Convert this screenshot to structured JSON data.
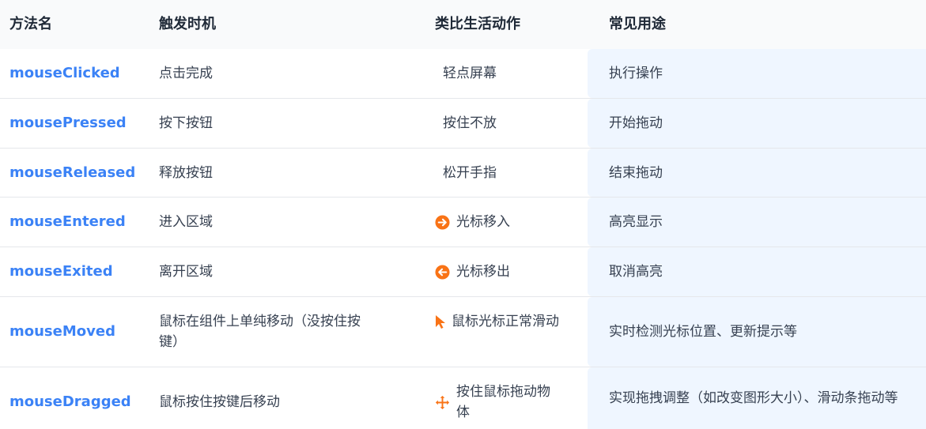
{
  "headers": {
    "method": "方法名",
    "trigger": "触发时机",
    "analogy": "类比生活动作",
    "usage": "常见用途"
  },
  "colors": {
    "method_text": "#3b82f6",
    "icon_orange": "#f97316",
    "usage_bg": "#eff6ff",
    "header_bg": "#f9fafb"
  },
  "rows": [
    {
      "method": "mouseClicked",
      "trigger": "点击完成",
      "analogy": "轻点屏幕",
      "analogy_icon": "",
      "usage": "执行操作"
    },
    {
      "method": "mousePressed",
      "trigger": "按下按钮",
      "analogy": "按住不放",
      "analogy_icon": "",
      "usage": "开始拖动"
    },
    {
      "method": "mouseReleased",
      "trigger": "释放按钮",
      "analogy": "松开手指",
      "analogy_icon": "",
      "usage": "结束拖动"
    },
    {
      "method": "mouseEntered",
      "trigger": "进入区域",
      "analogy": "光标移入",
      "analogy_icon": "arrow-circle-right-icon",
      "usage": "高亮显示"
    },
    {
      "method": "mouseExited",
      "trigger": "离开区域",
      "analogy": "光标移出",
      "analogy_icon": "arrow-circle-left-icon",
      "usage": "取消高亮"
    },
    {
      "method": "mouseMoved",
      "trigger": "鼠标在组件上单纯移动（没按住按键）",
      "analogy": "鼠标光标正常滑动",
      "analogy_icon": "mouse-pointer-icon",
      "usage": "实时检测光标位置、更新提示等"
    },
    {
      "method": "mouseDragged",
      "trigger": "鼠标按住按键后移动",
      "analogy": "按住鼠标拖动物体",
      "analogy_icon": "move-arrows-icon",
      "usage": "实现拖拽调整（如改变图形大小）、滑动条拖动等"
    }
  ]
}
